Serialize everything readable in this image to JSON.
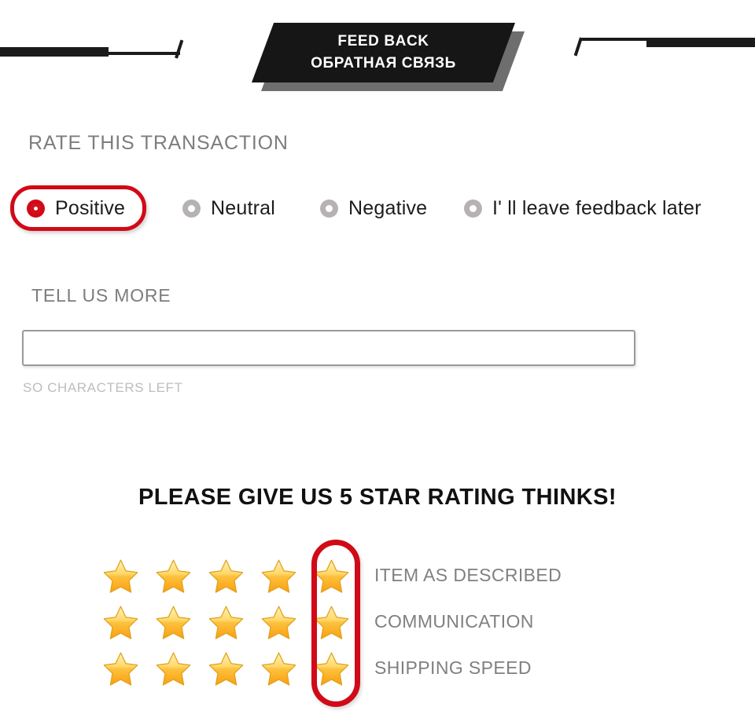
{
  "header": {
    "title_en": "FEED BACK",
    "title_ru": "ОБРАТНАЯ СВЯЗЬ",
    "banner_color": "#161616",
    "banner_shadow_color": "#6e6e6e",
    "rule_color": "#1b1b1b"
  },
  "rate_section": {
    "label": "RATE THIS TRANSACTION",
    "selected_value": "Positive",
    "highlight_color": "#d10a17",
    "options": [
      {
        "label": "Positive",
        "selected": true,
        "highlighted": true
      },
      {
        "label": "Neutral",
        "selected": false,
        "highlighted": false
      },
      {
        "label": "Negative",
        "selected": false,
        "highlighted": false
      },
      {
        "label": "I' ll leave feedback later",
        "selected": false,
        "highlighted": false
      }
    ]
  },
  "tell_us_more": {
    "label": "TELL US MORE",
    "value": "",
    "placeholder": "",
    "characters_left_text": "SO CHARACTERS LEFT"
  },
  "star_rating": {
    "heading": "PLEASE GIVE US 5 STAR RATING THINKS!",
    "stars_per_row": 5,
    "star_icon": "star-icon",
    "star_fill_top": "#ffe789",
    "star_fill_bottom": "#fba919",
    "star_outline": "#e0a21a",
    "highlight_color": "#d10a17",
    "highlighted_column": 5,
    "rows": [
      {
        "label": "ITEM AS DESCRIBED",
        "filled": 5
      },
      {
        "label": "COMMUNICATION",
        "filled": 5
      },
      {
        "label": "SHIPPING SPEED",
        "filled": 5
      }
    ]
  }
}
